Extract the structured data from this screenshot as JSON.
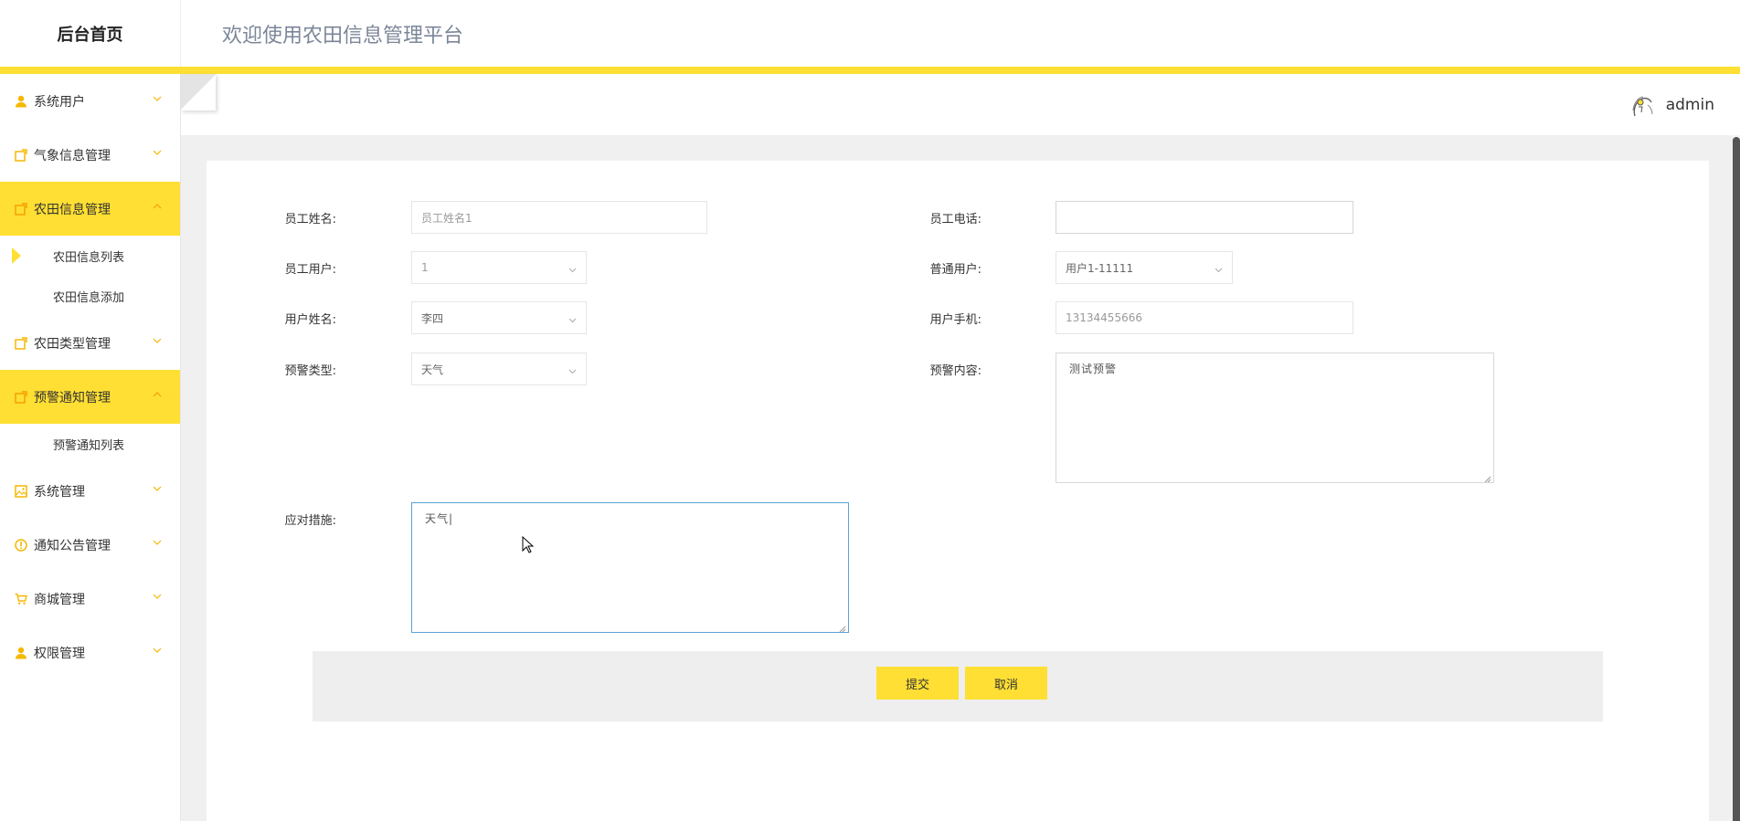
{
  "header": {
    "brand": "后台首页",
    "title": "欢迎使用农田信息管理平台"
  },
  "user": {
    "name": "admin"
  },
  "sidebar": {
    "items": [
      {
        "label": "系统用户",
        "icon": "user-icon",
        "expanded": false
      },
      {
        "label": "气象信息管理",
        "icon": "edit-icon",
        "expanded": false
      },
      {
        "label": "农田信息管理",
        "icon": "edit-icon",
        "expanded": true,
        "children": [
          "农田信息列表",
          "农田信息添加"
        ]
      },
      {
        "label": "农田类型管理",
        "icon": "edit-icon",
        "expanded": false
      },
      {
        "label": "预警通知管理",
        "icon": "edit-icon",
        "expanded": true,
        "children": [
          "预警通知列表"
        ]
      },
      {
        "label": "系统管理",
        "icon": "picture-icon",
        "expanded": false
      },
      {
        "label": "通知公告管理",
        "icon": "info-icon",
        "expanded": false
      },
      {
        "label": "商城管理",
        "icon": "cart-icon",
        "expanded": false
      },
      {
        "label": "权限管理",
        "icon": "user-icon",
        "expanded": false
      }
    ]
  },
  "form": {
    "employee_name": {
      "label": "员工姓名:",
      "placeholder": "员工姓名1"
    },
    "employee_phone": {
      "label": "员工电话:",
      "value": ""
    },
    "employee_user": {
      "label": "员工用户:",
      "value": "1"
    },
    "normal_user": {
      "label": "普通用户:",
      "value": "用户1-11111"
    },
    "user_name": {
      "label": "用户姓名:",
      "value": "李四"
    },
    "user_phone": {
      "label": "用户手机:",
      "value": "13134455666"
    },
    "warning_type": {
      "label": "预警类型:",
      "value": "天气"
    },
    "warning_content": {
      "label": "预警内容:",
      "value": "测试预警"
    },
    "measures": {
      "label": "应对措施:",
      "value": "天气|"
    },
    "submit_label": "提交",
    "cancel_label": "取消"
  },
  "colors": {
    "accent": "#ffdf33",
    "focus_border": "#5aa3d6"
  }
}
